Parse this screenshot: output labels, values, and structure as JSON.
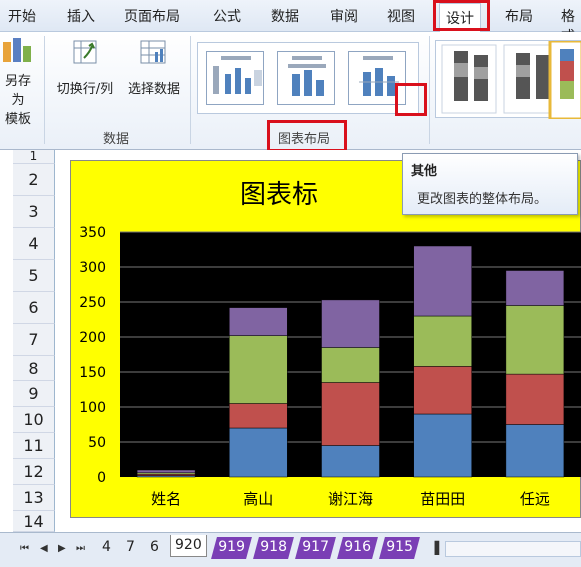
{
  "ribbon_tabs": [
    "开始",
    "插入",
    "页面布局",
    "公式",
    "数据",
    "审阅",
    "视图",
    "设计",
    "布局",
    "格式"
  ],
  "active_tab": "设计",
  "ribbon": {
    "save_as_template_line1": "另存为",
    "save_as_template_line2": "模板",
    "switch_row_col": "切换行/列",
    "select_data": "选择数据",
    "data_group": "数据",
    "chart_layout_group": "图表布局"
  },
  "tooltip": {
    "title": "其他",
    "description": "更改图表的整体布局。"
  },
  "row_numbers": [
    "1",
    "2",
    "3",
    "4",
    "5",
    "6",
    "7",
    "8",
    "9",
    "10",
    "11",
    "12",
    "13",
    "14"
  ],
  "chart_title_text": "图表标",
  "sheet_tabs": {
    "plain": [
      "4",
      "7",
      "6"
    ],
    "active": "920",
    "purple": [
      "919",
      "918",
      "917",
      "916",
      "915"
    ]
  },
  "colors": {
    "series1": "#4f81bd",
    "series2": "#c0504d",
    "series3": "#9bbb59",
    "series4": "#8064a2",
    "chart_bg": "#ffff00",
    "plot_bg": "#000000",
    "highlight": "#d9101c"
  },
  "chart_data": {
    "type": "bar",
    "stacked": true,
    "categories": [
      "姓名",
      "高山",
      "谢江海",
      "苗田田",
      "任远"
    ],
    "series": [
      {
        "values": [
          2,
          70,
          45,
          90,
          75
        ]
      },
      {
        "values": [
          2,
          35,
          90,
          68,
          72
        ]
      },
      {
        "values": [
          2,
          97,
          50,
          72,
          98
        ]
      },
      {
        "values": [
          4,
          40,
          68,
          100,
          50
        ]
      }
    ],
    "ylim": [
      0,
      350
    ],
    "yticks": [
      0,
      50,
      100,
      150,
      200,
      250,
      300,
      350
    ],
    "grid": true
  }
}
